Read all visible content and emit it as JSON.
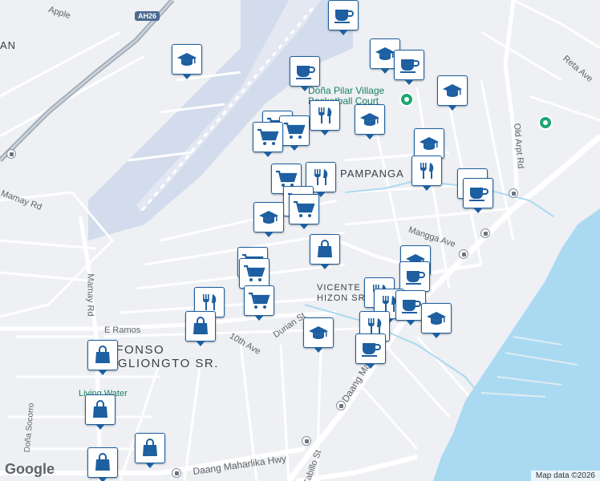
{
  "map": {
    "colors": {
      "land": "#eef0f3",
      "water": "#aadaf1",
      "airport": "#d3dcec",
      "road": "#ffffff",
      "highway": "#9aa6b4",
      "marker_border": "#1d5fa0",
      "poi_green": "#1ea673"
    },
    "labels": {
      "apple": "Apple",
      "an": "AN",
      "mamay_rd_left": "Mamay Rd",
      "mamay_rd": "Mamay Rd",
      "pampanga": "PAMPANGA",
      "vicente_hizon": "VICENTE\nHIZON SR.",
      "alfonso": "ALFONSO\nANGLIONGTO SR.",
      "mangga_ave": "Mangga Ave",
      "old_airport_rd": "Old Arpt Rd",
      "reta_ave": "Reta Ave",
      "e_ramos": "E Ramos",
      "tenth_ave": "10th Ave",
      "durian_st": "Durian St",
      "dona_socorro": "Doña Socorro",
      "daang_maharlika_hwy": "Daang Maharlika Hwy",
      "daang_maharlika_diag": "Daang Maharlika",
      "cabillo_st": "Cabillo St",
      "living_water": "Living Water",
      "dona_pilar_court": "Doña Pilar Village\nBasketball Court"
    },
    "shield": "AH26",
    "google_logo": "Google",
    "attribution": "Map data ©2026",
    "markers": [
      {
        "type": "cafe",
        "icon": "coffee-icon"
      },
      {
        "type": "school",
        "icon": "school-icon"
      },
      {
        "type": "restaurant",
        "icon": "restaurant-icon"
      },
      {
        "type": "grocery",
        "icon": "shopping-cart-icon"
      },
      {
        "type": "shop",
        "icon": "shopping-bag-icon"
      }
    ]
  }
}
